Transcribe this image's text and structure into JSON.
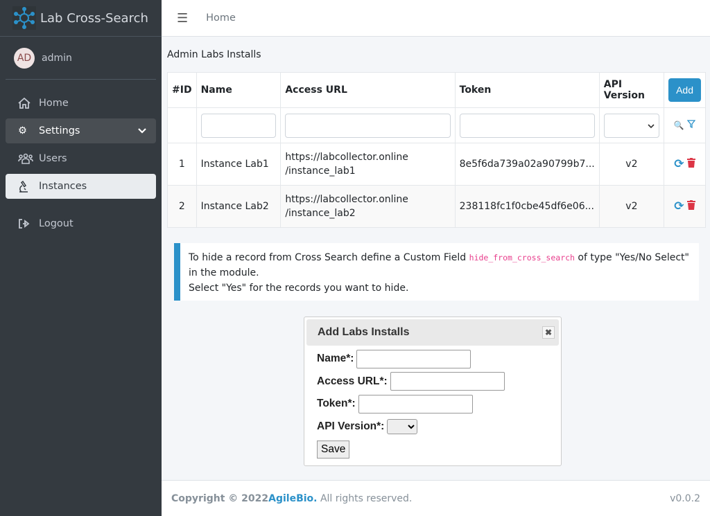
{
  "app": {
    "title": "Lab Cross-Search"
  },
  "user": {
    "initials": "AD",
    "name": "admin"
  },
  "sidebar": {
    "items": [
      {
        "label": "Home",
        "icon": "home-icon"
      },
      {
        "label": "Settings",
        "icon": "cogs-icon",
        "expanded": true
      },
      {
        "label": "Users",
        "icon": "users-icon"
      },
      {
        "label": "Instances",
        "icon": "microscope-icon",
        "active": true
      },
      {
        "label": "Logout",
        "icon": "logout-icon"
      }
    ]
  },
  "header": {
    "breadcrumb": "Home"
  },
  "page": {
    "title": "Admin Labs Installs"
  },
  "table": {
    "columns": [
      "#ID",
      "Name",
      "Access URL",
      "Token",
      "API Version"
    ],
    "add_label": "Add",
    "rows": [
      {
        "id": "1",
        "name": "Instance Lab1",
        "url1": "https://labcollector.online",
        "url2": "/instance_lab1",
        "token": "8e5f6da739a02a90799b7...",
        "api": "v2"
      },
      {
        "id": "2",
        "name": "Instance Lab2",
        "url1": "https://labcollector.online",
        "url2": "/instance_lab2",
        "token": "238118fc1f0cbe45df6e06...",
        "api": "v2"
      }
    ]
  },
  "callout": {
    "text1": "To hide a record from Cross Search define a Custom Field ",
    "code": "hide_from_cross_search",
    "text2": " of type \"Yes/No Select\" in the module.",
    "text3": "Select \"Yes\" for the records you want to hide."
  },
  "dialog": {
    "title": "Add Labs Installs",
    "close": "✖",
    "name_label": "Name*:",
    "url_label": "Access URL*:",
    "token_label": "Token*:",
    "api_label": "API Version*:",
    "save_label": "Save"
  },
  "footer": {
    "copyright": "Copyright © 2022 ",
    "company": "AgileBio.",
    "rights": " All rights reserved.",
    "version": "v0.0.2"
  },
  "colors": {
    "sidebar": "#343a40",
    "accent": "#2b91c9",
    "danger": "#dc3545"
  }
}
